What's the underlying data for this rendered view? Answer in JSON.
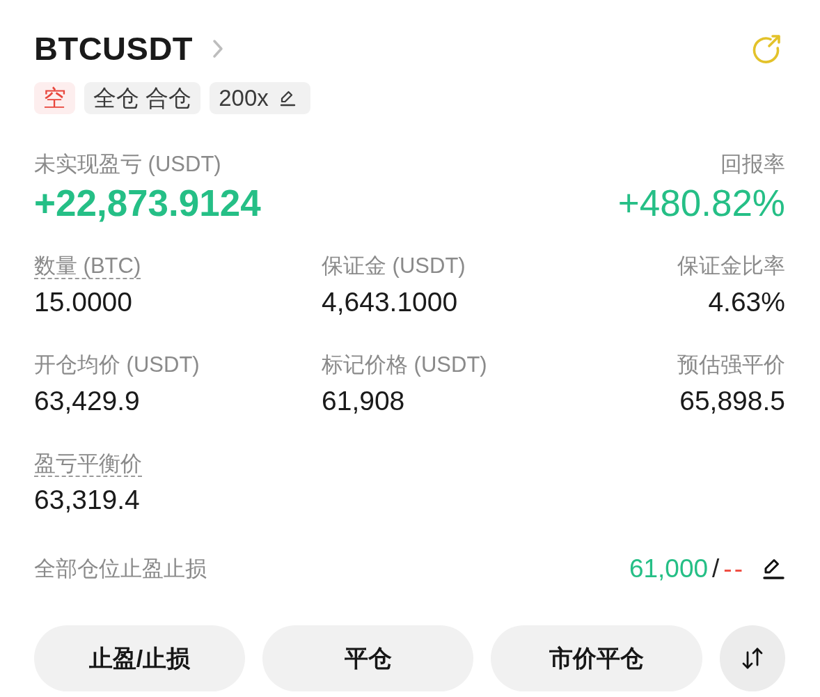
{
  "header": {
    "symbol": "BTCUSDT"
  },
  "tags": [
    {
      "kind": "side",
      "label": "空"
    },
    {
      "kind": "mode",
      "label": "全仓 合仓"
    },
    {
      "kind": "leverage",
      "label": "200x"
    }
  ],
  "pnl": {
    "label": "未实现盈亏 (USDT)",
    "value": "+22,873.9124"
  },
  "roe": {
    "label": "回报率",
    "value": "+480.82%"
  },
  "fields": [
    {
      "label": "数量 (BTC)",
      "value": "15.0000",
      "underlined": true
    },
    {
      "label": "保证金 (USDT)",
      "value": "4,643.1000",
      "underlined": false
    },
    {
      "label": "保证金比率",
      "value": "4.63%",
      "underlined": false
    },
    {
      "label": "开仓均价 (USDT)",
      "value": "63,429.9",
      "underlined": false
    },
    {
      "label": "标记价格 (USDT)",
      "value": "61,908",
      "underlined": false
    },
    {
      "label": "预估强平价",
      "value": "65,898.5",
      "underlined": false
    },
    {
      "label": "盈亏平衡价",
      "value": "63,319.4",
      "underlined": true
    }
  ],
  "tpsl": {
    "label": "全部仓位止盈止损",
    "take_profit": "61,000",
    "separator": "/",
    "stop_loss": "--"
  },
  "actions": [
    "止盈/止损",
    "平仓",
    "市价平仓"
  ]
}
